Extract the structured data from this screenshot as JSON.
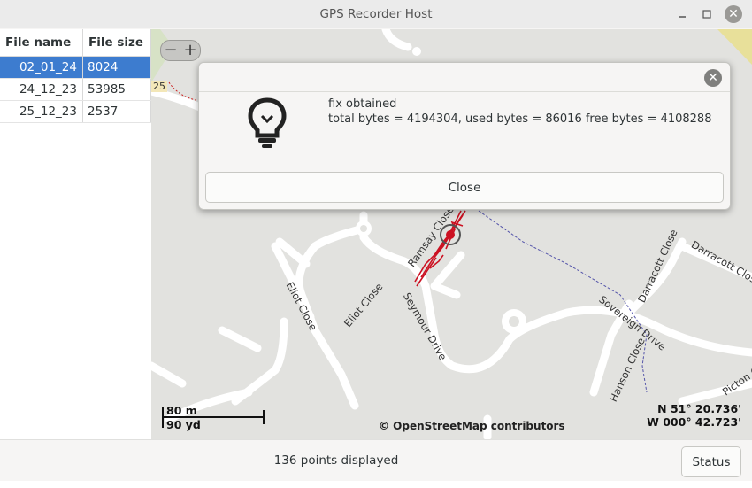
{
  "window": {
    "title": "GPS Recorder Host"
  },
  "file_table": {
    "headers": [
      "File name",
      "File size"
    ],
    "rows": [
      {
        "name": "02_01_24",
        "size": "8024",
        "selected": true
      },
      {
        "name": "24_12_23",
        "size": "53985",
        "selected": false
      },
      {
        "name": "25_12_23",
        "size": "2537",
        "selected": false
      }
    ]
  },
  "map": {
    "zoom_out": "−",
    "zoom_in": "+",
    "road_ref": "25",
    "streets": [
      "Eliot Close",
      "Eliot Close",
      "Ramsay Close",
      "Seymour Drive",
      "Sovereign Drive",
      "Darracott Close",
      "Darracott Close",
      "Hanson Close",
      "Picton C"
    ],
    "scale": {
      "metric": "80 m",
      "imperial": "90 yd"
    },
    "attribution": "© OpenStreetMap contributors",
    "coords": {
      "lat": "N 51° 20.736'",
      "lon": "W 000° 42.723'"
    }
  },
  "dialog": {
    "icon": "lightbulb-icon",
    "line1": "fix  obtained",
    "line2": "total bytes = 4194304, used bytes = 86016 free bytes = 4108288",
    "button": "Close"
  },
  "statusbar": {
    "points_text": "136 points displayed",
    "status_button": "Status"
  },
  "colors": {
    "selection": "#3d7ccf",
    "track": "#cc1122",
    "map_bg": "#e2e2df"
  }
}
